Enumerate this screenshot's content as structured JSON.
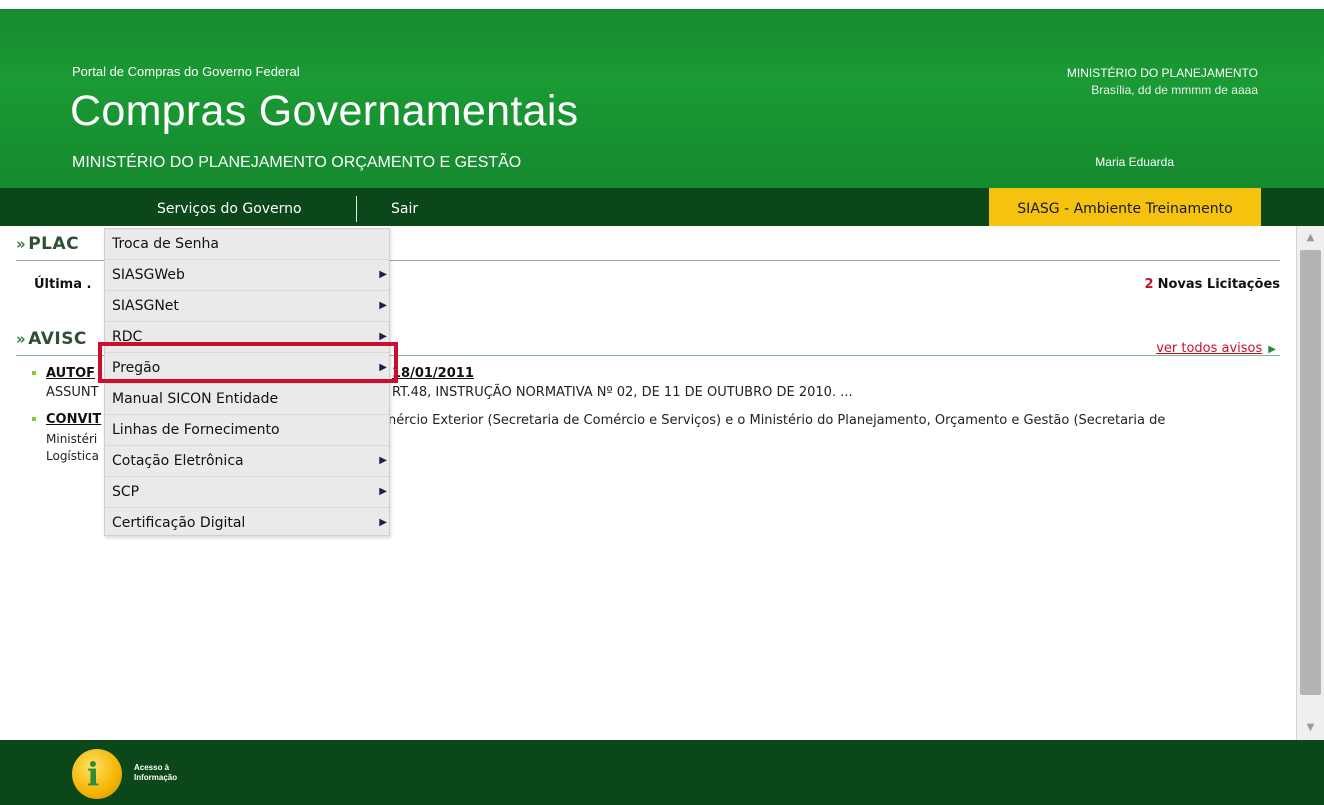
{
  "header": {
    "portal_sub": "Portal de Compras do Governo Federal",
    "title": "Compras Governamentais",
    "ministry": "MINISTÉRIO DO PLANEJAMENTO ORÇAMENTO E GESTÃO",
    "right_ministry": "MINISTÉRIO DO PLANEJAMENTO",
    "right_date": "Brasília, dd de mmmm de aaaa",
    "user": "Maria Eduarda"
  },
  "nav": {
    "servicos": "Serviços do Governo",
    "sair": "Sair",
    "environment": "SIASG - Ambiente Treinamento"
  },
  "sections": {
    "placar_title": "PLAC",
    "ultima": "Última .",
    "novas_count": "2",
    "novas_label": "Novas Licitações",
    "avisos_title": "AVISC",
    "ver_todos": "ver todos avisos"
  },
  "avisos": [
    {
      "title_prefix": "AUTOF",
      "title_suffix": "18/01/2011",
      "line_prefix": "ASSUNT",
      "line_suffix": "RT.48, INSTRUÇÃO NORMATIVA Nº 02, DE 11 DE OUTUBRO DE 2010. ..."
    },
    {
      "title_prefix": "CONVIT",
      "line_suffix": "nércio Exterior (Secretaria de Comércio e Serviços) e o Ministério do Planejamento, Orçamento e Gestão (Secretaria de",
      "line2_prefix": "Ministéri",
      "line3_prefix": "Logística"
    }
  ],
  "menu": {
    "items": [
      {
        "label": "Troca de Senha",
        "arrow": ""
      },
      {
        "label": "SIASGWeb",
        "arrow": "▶"
      },
      {
        "label": "SIASGNet",
        "arrow": "▶"
      },
      {
        "label": "RDC",
        "arrow": "▶"
      },
      {
        "label": "Pregão",
        "arrow": "▶"
      },
      {
        "label": "Manual SICON Entidade",
        "arrow": ""
      },
      {
        "label": "Linhas de Fornecimento",
        "arrow": ""
      },
      {
        "label": "Cotação Eletrônica",
        "arrow": "▶"
      },
      {
        "label": "SCP",
        "arrow": "▶"
      },
      {
        "label": "Certificação Digital",
        "arrow": "▶"
      }
    ],
    "highlighted": "Pregão"
  },
  "footer": {
    "info_label_1": "Acesso à",
    "info_label_2": "Informação",
    "info_icon": "info-icon"
  },
  "scrollbar": {
    "up": "▲",
    "down": "▼"
  },
  "colors": {
    "header_green": "#188a30",
    "nav_dark_green": "#0b4719",
    "env_yellow": "#f4c20f",
    "highlight_red": "#c8102e",
    "accent_red": "#c8102e"
  }
}
